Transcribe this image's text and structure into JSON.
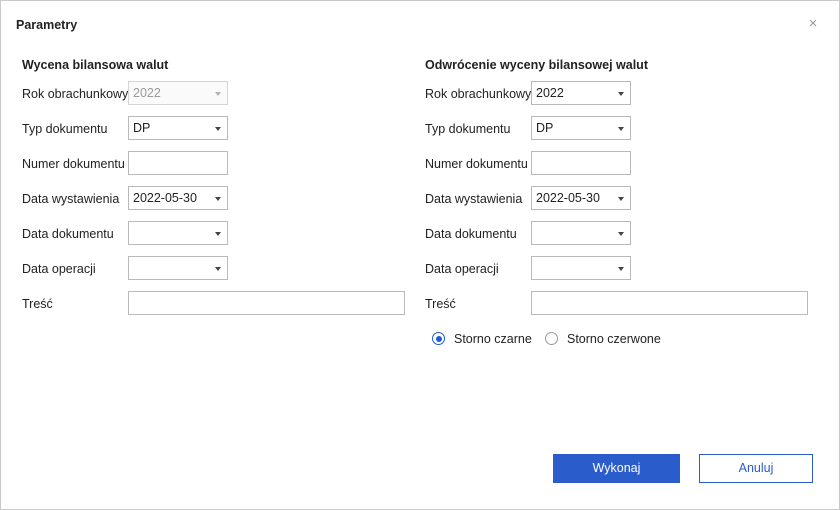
{
  "dialog": {
    "title": "Parametry"
  },
  "left": {
    "title": "Wycena bilansowa walut",
    "labels": {
      "rok": "Rok obrachunkowy",
      "typ": "Typ dokumentu",
      "numer": "Numer dokumentu",
      "data_wyst": "Data wystawienia",
      "data_dok": "Data dokumentu",
      "data_op": "Data operacji",
      "tresc": "Treść"
    },
    "values": {
      "rok": "2022",
      "typ": "DP",
      "numer": "",
      "data_wyst": "2022-05-30",
      "data_dok": "",
      "data_op": "",
      "tresc": ""
    }
  },
  "right": {
    "title": "Odwrócenie wyceny bilansowej walut",
    "labels": {
      "rok": "Rok obrachunkowy",
      "typ": "Typ dokumentu",
      "numer": "Numer dokumentu",
      "data_wyst": "Data wystawienia",
      "data_dok": "Data dokumentu",
      "data_op": "Data operacji",
      "tresc": "Treść"
    },
    "values": {
      "rok": "2022",
      "typ": "DP",
      "numer": "",
      "data_wyst": "2022-05-30",
      "data_dok": "",
      "data_op": "",
      "tresc": ""
    },
    "radios": {
      "czarne": "Storno czarne",
      "czerwone": "Storno czerwone",
      "selected": "czarne"
    }
  },
  "buttons": {
    "wykonaj": "Wykonaj",
    "anuluj": "Anuluj"
  }
}
